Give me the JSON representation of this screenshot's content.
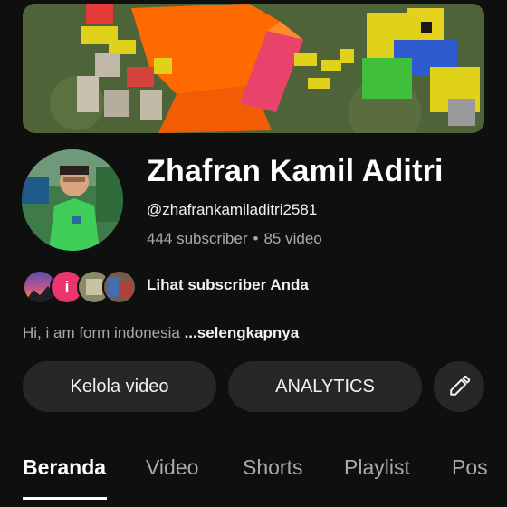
{
  "channel": {
    "name": "Zhafran Kamil Aditri",
    "handle": "@zhafrankamiladitri2581",
    "subscribers": "444 subscriber",
    "separator": "•",
    "videos": "85 video"
  },
  "subscribers_row": {
    "avatar_letter": "i",
    "label": "Lihat subscriber Anda"
  },
  "description": {
    "text": "Hi, i am form indonesia",
    "more": "...selengkapnya"
  },
  "actions": {
    "manage_label": "Kelola video",
    "analytics_label": "ANALYTICS",
    "edit_icon": "pencil-icon"
  },
  "tabs": [
    {
      "label": "Beranda",
      "active": true
    },
    {
      "label": "Video",
      "active": false
    },
    {
      "label": "Shorts",
      "active": false
    },
    {
      "label": "Playlist",
      "active": false
    },
    {
      "label": "Pos",
      "active": false
    }
  ],
  "colors": {
    "background": "#0f0f0f",
    "button": "#272727",
    "secondary_text": "#aaaaaa",
    "subscriber_avatar_pink": "#e8356d"
  }
}
